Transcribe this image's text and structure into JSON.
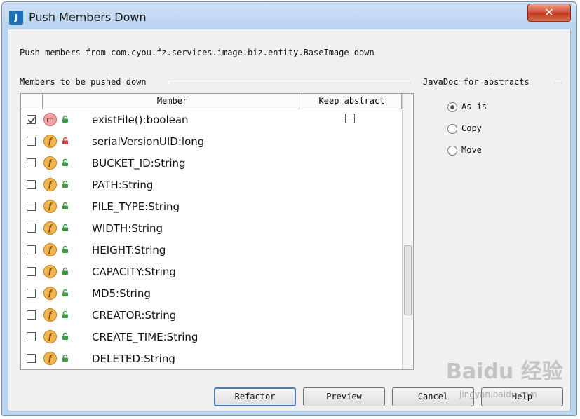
{
  "window": {
    "title": "Push Members Down",
    "close_glyph": "✕",
    "app_icon": "intellij-icon"
  },
  "description": "Push members from com.cyou.fz.services.image.biz.entity.BaseImage down",
  "members_group": {
    "label": "Members to be pushed down",
    "columns": {
      "member": "Member",
      "keep_abstract": "Keep abstract"
    },
    "rows": [
      {
        "name": "existFile():boolean",
        "kind": "m",
        "icon": "method-icon",
        "access": "public",
        "checked": true,
        "keep_abstract_box": true
      },
      {
        "name": "serialVersionUID:long",
        "kind": "f",
        "icon": "field-icon",
        "access": "private",
        "checked": false
      },
      {
        "name": "BUCKET_ID:String",
        "kind": "f",
        "icon": "field-icon",
        "access": "public",
        "checked": false
      },
      {
        "name": "PATH:String",
        "kind": "f",
        "icon": "field-icon",
        "access": "public",
        "checked": false
      },
      {
        "name": "FILE_TYPE:String",
        "kind": "f",
        "icon": "field-icon",
        "access": "public",
        "checked": false
      },
      {
        "name": "WIDTH:String",
        "kind": "f",
        "icon": "field-icon",
        "access": "public",
        "checked": false
      },
      {
        "name": "HEIGHT:String",
        "kind": "f",
        "icon": "field-icon",
        "access": "public",
        "checked": false
      },
      {
        "name": "CAPACITY:String",
        "kind": "f",
        "icon": "field-icon",
        "access": "public",
        "checked": false
      },
      {
        "name": "MD5:String",
        "kind": "f",
        "icon": "field-icon",
        "access": "public",
        "checked": false
      },
      {
        "name": "CREATOR:String",
        "kind": "f",
        "icon": "field-icon",
        "access": "public",
        "checked": false
      },
      {
        "name": "CREATE_TIME:String",
        "kind": "f",
        "icon": "field-icon",
        "access": "public",
        "checked": false
      },
      {
        "name": "DELETED:String",
        "kind": "f",
        "icon": "field-icon",
        "access": "public",
        "checked": false
      }
    ]
  },
  "javadoc_group": {
    "label": "JavaDoc for abstracts",
    "options": [
      {
        "label": "As is",
        "selected": true
      },
      {
        "label": "Copy",
        "selected": false
      },
      {
        "label": "Move",
        "selected": false
      }
    ]
  },
  "buttons": {
    "refactor": "Refactor",
    "preview": "Preview",
    "cancel": "Cancel",
    "help": "Help"
  },
  "watermark": {
    "text": "Baidu 经验",
    "sub": "jingyan.baidu.com"
  },
  "colors": {
    "public_lock": "#3c9a3c",
    "private_lock": "#d23b3b",
    "default_button_border": "#4b7fc4"
  }
}
